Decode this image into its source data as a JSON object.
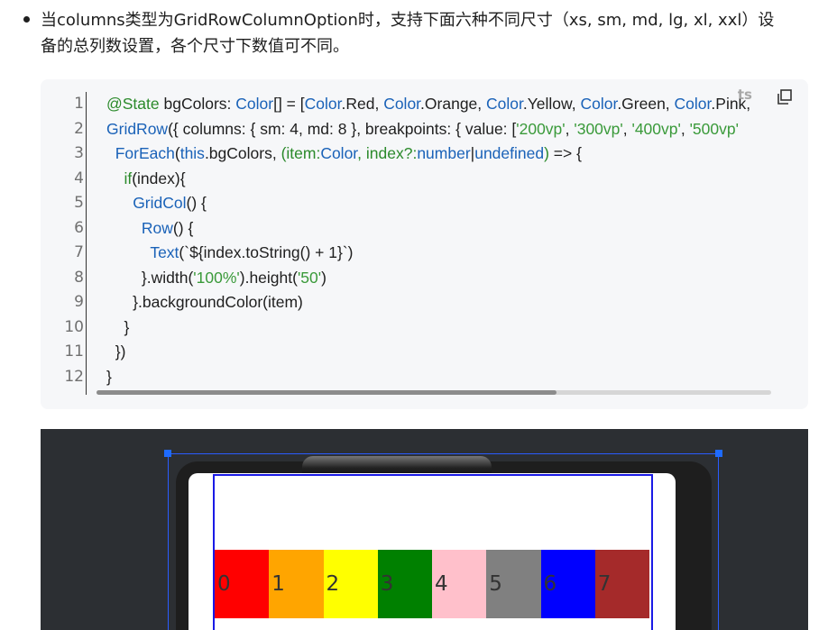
{
  "bullet": {
    "line1": "当columns类型为GridRowColumnOption时，支持下面六种不同尺寸（xs, sm, md, lg, xl, xxl）设",
    "line2": "备的总列数设置，各个尺寸下数值可不同。"
  },
  "code": {
    "language_tag": "ts",
    "line_numbers": [
      "1",
      "2",
      "3",
      "4",
      "5",
      "6",
      "7",
      "8",
      "9",
      "10",
      "11",
      "12"
    ],
    "lines": [
      [
        {
          "c": "t-dec",
          "t": "@State"
        },
        {
          "c": "t-plain",
          "t": " bgColors: "
        },
        {
          "c": "t-type",
          "t": "Color"
        },
        {
          "c": "t-plain",
          "t": "[] = ["
        },
        {
          "c": "t-type",
          "t": "Color"
        },
        {
          "c": "t-plain",
          "t": ".Red, "
        },
        {
          "c": "t-type",
          "t": "Color"
        },
        {
          "c": "t-plain",
          "t": ".Orange, "
        },
        {
          "c": "t-type",
          "t": "Color"
        },
        {
          "c": "t-plain",
          "t": ".Yellow, "
        },
        {
          "c": "t-type",
          "t": "Color"
        },
        {
          "c": "t-plain",
          "t": ".Green, "
        },
        {
          "c": "t-type",
          "t": "Color"
        },
        {
          "c": "t-plain",
          "t": ".Pink, "
        }
      ],
      [
        {
          "c": "t-type",
          "t": "GridRow"
        },
        {
          "c": "t-plain",
          "t": "({ columns: { sm: "
        },
        {
          "c": "t-num",
          "t": "4"
        },
        {
          "c": "t-plain",
          "t": ", md: "
        },
        {
          "c": "t-num",
          "t": "8"
        },
        {
          "c": "t-plain",
          "t": " }, breakpoints: { value: ["
        },
        {
          "c": "t-str",
          "t": "'200vp'"
        },
        {
          "c": "t-plain",
          "t": ", "
        },
        {
          "c": "t-str",
          "t": "'300vp'"
        },
        {
          "c": "t-plain",
          "t": ", "
        },
        {
          "c": "t-str",
          "t": "'400vp'"
        },
        {
          "c": "t-plain",
          "t": ", "
        },
        {
          "c": "t-str",
          "t": "'500vp'"
        }
      ],
      [
        {
          "c": "t-plain",
          "t": "  "
        },
        {
          "c": "t-type",
          "t": "ForEach"
        },
        {
          "c": "t-plain",
          "t": "("
        },
        {
          "c": "t-type",
          "t": "this"
        },
        {
          "c": "t-plain",
          "t": ".bgColors, "
        },
        {
          "c": "t-param",
          "t": "(item:"
        },
        {
          "c": "t-type",
          "t": "Color"
        },
        {
          "c": "t-param",
          "t": ", index?:"
        },
        {
          "c": "t-type",
          "t": "number"
        },
        {
          "c": "t-plain",
          "t": "|"
        },
        {
          "c": "t-type",
          "t": "undefined"
        },
        {
          "c": "t-param",
          "t": ")"
        },
        {
          "c": "t-plain",
          "t": " => {"
        }
      ],
      [
        {
          "c": "t-plain",
          "t": "    "
        },
        {
          "c": "t-kw",
          "t": "if"
        },
        {
          "c": "t-plain",
          "t": "(index){"
        }
      ],
      [
        {
          "c": "t-plain",
          "t": "      "
        },
        {
          "c": "t-type",
          "t": "GridCol"
        },
        {
          "c": "t-plain",
          "t": "() {"
        }
      ],
      [
        {
          "c": "t-plain",
          "t": "        "
        },
        {
          "c": "t-type",
          "t": "Row"
        },
        {
          "c": "t-plain",
          "t": "() {"
        }
      ],
      [
        {
          "c": "t-plain",
          "t": "          "
        },
        {
          "c": "t-type",
          "t": "Text"
        },
        {
          "c": "t-plain",
          "t": "(`${index.toString() + 1}`)"
        }
      ],
      [
        {
          "c": "t-plain",
          "t": "        }.width("
        },
        {
          "c": "t-str",
          "t": "'100%'"
        },
        {
          "c": "t-plain",
          "t": ").height("
        },
        {
          "c": "t-str",
          "t": "'50'"
        },
        {
          "c": "t-plain",
          "t": ")"
        }
      ],
      [
        {
          "c": "t-plain",
          "t": "      }.backgroundColor(item)"
        }
      ],
      [
        {
          "c": "t-plain",
          "t": "    }"
        }
      ],
      [
        {
          "c": "t-plain",
          "t": "  })"
        }
      ],
      [
        {
          "c": "t-plain",
          "t": "}"
        }
      ]
    ]
  },
  "preview": {
    "cells": [
      {
        "label": "0",
        "color": "#ff0000"
      },
      {
        "label": "1",
        "color": "#ffa500"
      },
      {
        "label": "2",
        "color": "#ffff00"
      },
      {
        "label": "3",
        "color": "#008000"
      },
      {
        "label": "4",
        "color": "#ffc0cb"
      },
      {
        "label": "5",
        "color": "#808080"
      },
      {
        "label": "6",
        "color": "#0000ff"
      },
      {
        "label": "7",
        "color": "#a52a2a"
      }
    ]
  }
}
